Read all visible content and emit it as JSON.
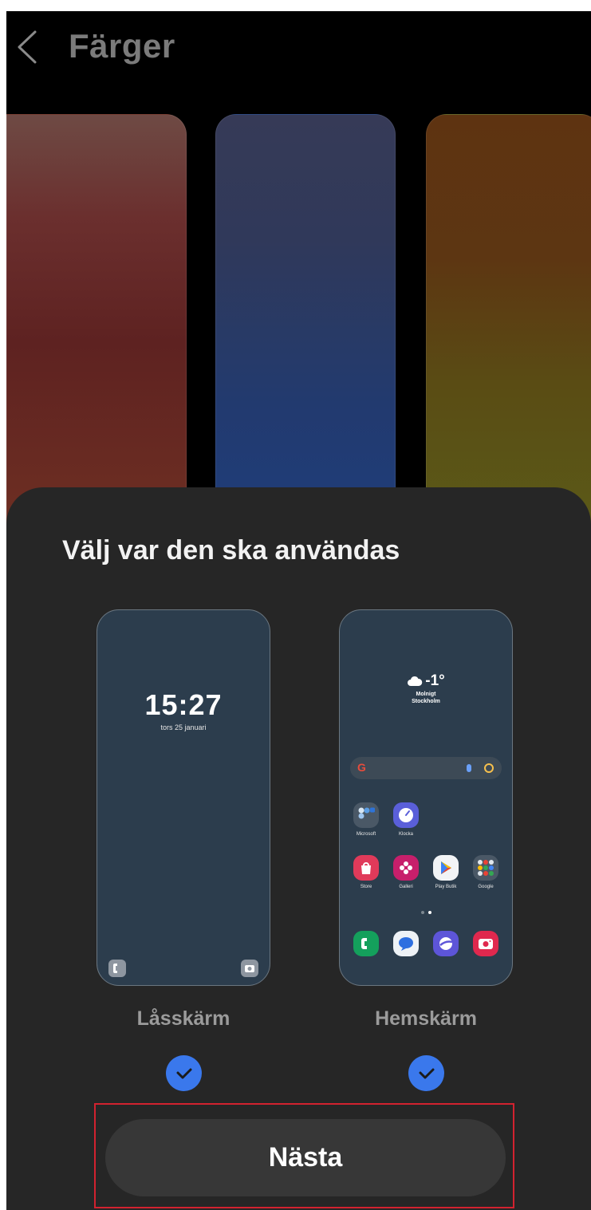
{
  "header": {
    "title": "Färger",
    "back_icon": "chevron-left-icon"
  },
  "wallpapers": [
    {
      "name": "red",
      "colors": [
        "#6e4a44",
        "#5e2221"
      ]
    },
    {
      "name": "blue",
      "colors": [
        "#363a57",
        "#1f3d7a"
      ]
    },
    {
      "name": "orange",
      "colors": [
        "#5e3311",
        "#5b5a18"
      ]
    }
  ],
  "sheet": {
    "title": "Välj var den ska användas",
    "lock_screen": {
      "label": "Låsskärm",
      "time": "15:27",
      "date": "tors 25 januari",
      "selected": true
    },
    "home_screen": {
      "label": "Hemskärm",
      "weather": {
        "temp": "-1°",
        "condition": "Molnigt",
        "city": "Stockholm"
      },
      "apps_row1": [
        {
          "label": "Microsoft",
          "icon": "microsoft-folder-icon"
        },
        {
          "label": "Klocka",
          "icon": "clock-icon"
        }
      ],
      "apps_row2": [
        {
          "label": "Store",
          "icon": "store-bag-icon"
        },
        {
          "label": "Galleri",
          "icon": "gallery-flower-icon"
        },
        {
          "label": "Play Butik",
          "icon": "play-store-icon"
        },
        {
          "label": "Google",
          "icon": "google-folder-icon"
        }
      ],
      "dock": [
        "phone-icon",
        "messages-icon",
        "internet-icon",
        "camera-icon"
      ],
      "selected": true
    },
    "next_button": "Nästa"
  },
  "colors": {
    "accent": "#3a78ec",
    "highlight": "#d2222f",
    "sheet_bg": "#262626"
  }
}
